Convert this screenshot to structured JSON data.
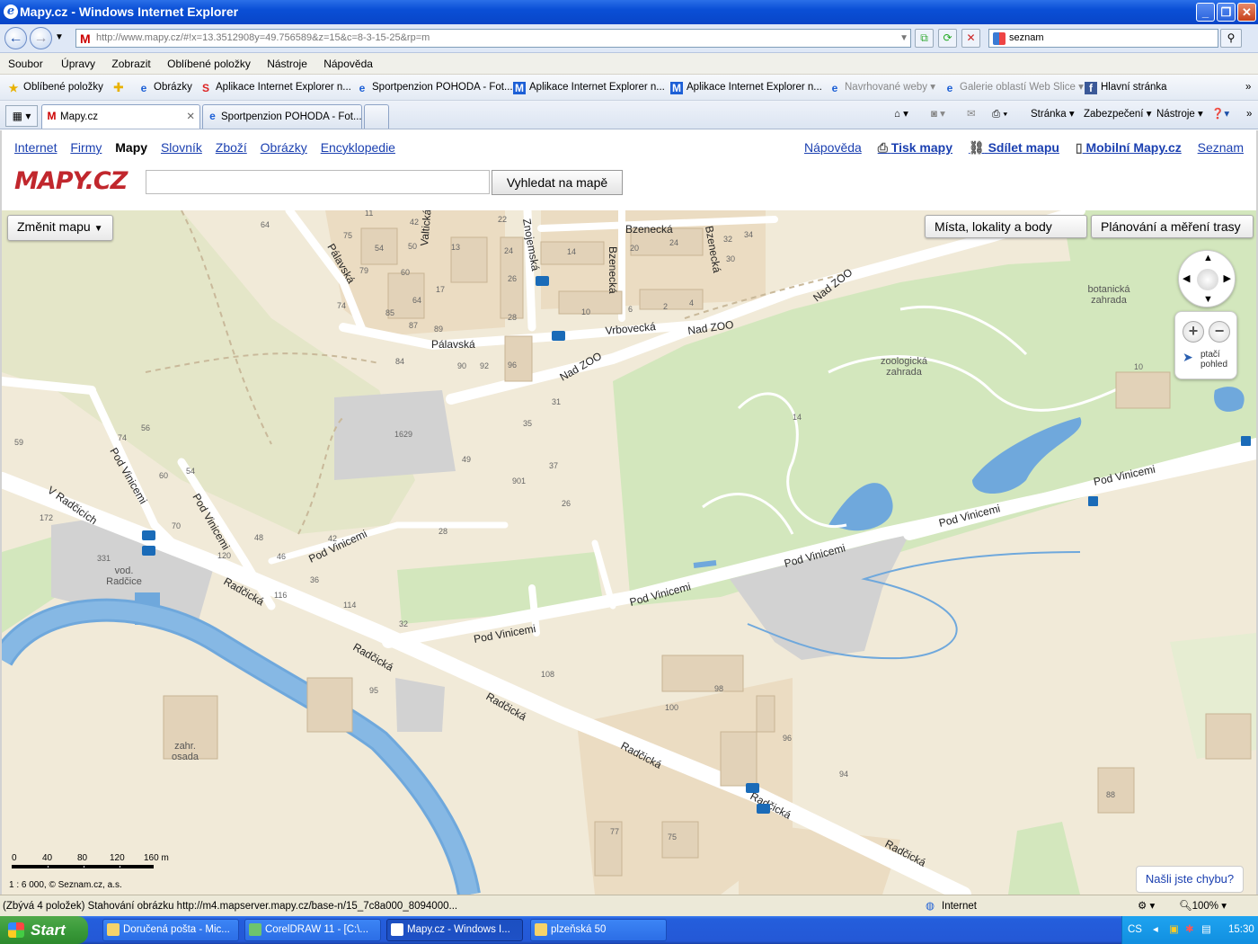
{
  "window": {
    "title": "Mapy.cz - Windows Internet Explorer"
  },
  "address": {
    "url": "http://www.mapy.cz/#!x=13.3512908y=49.756589&z=15&c=8-3-15-25&rp=m",
    "search_value": "seznam"
  },
  "menu": [
    "Soubor",
    "Úpravy",
    "Zobrazit",
    "Oblíbené položky",
    "Nástroje",
    "Nápověda"
  ],
  "favorites": {
    "label": "Oblíbené položky",
    "items": [
      "Obrázky",
      "Aplikace Internet Explorer n...",
      "Sportpenzion POHODA - Fot...",
      "Aplikace Internet Explorer n...",
      "Aplikace Internet Explorer n...",
      "Navrhované weby",
      "Galerie oblastí Web Slice",
      "Hlavní stránka"
    ]
  },
  "tabs": [
    {
      "label": "Mapy.cz",
      "active": true
    },
    {
      "label": "Sportpenzion POHODA - Fot...",
      "active": false
    }
  ],
  "commands": [
    "Stránka",
    "Zabezpečení",
    "Nástroje"
  ],
  "page": {
    "nav_left": [
      "Internet",
      "Firmy",
      "Mapy",
      "Slovník",
      "Zboží",
      "Obrázky",
      "Encyklopedie"
    ],
    "nav_right": [
      "Nápověda",
      "Tisk mapy",
      "Sdílet mapu",
      "Mobilní Mapy.cz",
      "Seznam"
    ],
    "logo": "MAPY.CZ",
    "search_button": "Vyhledat na mapě",
    "change_map": "Změnit mapu",
    "places_button": "Místa, lokality a body",
    "route_button": "Plánování a měření trasy",
    "bird_view": [
      "ptačí",
      "pohled"
    ],
    "report_error": "Našli jste chybu?",
    "scale_labels": [
      "0",
      "40",
      "80",
      "120",
      "160 m"
    ],
    "scale_note": "1 : 6 000, © Seznam.cz, a.s."
  },
  "map_labels": {
    "streets": [
      "Bzenecká",
      "Bzenecká",
      "Bzenecká",
      "Znojemská",
      "Valtická",
      "Pálavská",
      "Pálavská",
      "Vrbovecká",
      "Nad ZOO",
      "Nad ZOO",
      "Nad ZOO",
      "Pod Vinicemi",
      "Pod Vinicemi",
      "Pod Vinicemi",
      "Pod Vinicemi",
      "Pod Vinicemi",
      "Pod Vinicemi",
      "Pod Vinicemi",
      "Pod Vinicemi",
      "V Radčicích",
      "Radčická",
      "Radčická",
      "Radčická",
      "Radčická",
      "Radčická",
      "Radčická"
    ],
    "areas": [
      "botanická zahrada",
      "zoologická zahrada",
      "vod. Radčice",
      "zahr. osada"
    ],
    "numbers": [
      "64",
      "11",
      "75",
      "42",
      "54",
      "50",
      "13",
      "22",
      "24",
      "26",
      "28",
      "14",
      "20",
      "24",
      "32",
      "34",
      "30",
      "79",
      "60",
      "17",
      "74",
      "85",
      "64",
      "87",
      "89",
      "10",
      "6",
      "2",
      "4",
      "84",
      "90",
      "92",
      "96",
      "31",
      "35",
      "1629",
      "49",
      "37",
      "901",
      "26",
      "28",
      "56",
      "74",
      "60",
      "54",
      "70",
      "48",
      "46",
      "120",
      "116",
      "42",
      "36",
      "114",
      "32",
      "108",
      "95",
      "98",
      "100",
      "96",
      "94",
      "88",
      "77",
      "75",
      "14",
      "10",
      "59",
      "172",
      "331"
    ]
  },
  "status": {
    "text": "(Zbývá 4 položek) Stahování obrázku http://m4.mapserver.mapy.cz/base-n/15_7c8a000_8094000...",
    "zone": "Internet",
    "zoom": "100%"
  },
  "taskbar": {
    "start": "Start",
    "items": [
      "Doručená pošta - Mic...",
      "CorelDRAW 11 - [C:\\...",
      "Mapy.cz - Windows I...",
      "plzeňská 50"
    ],
    "lang": "CS",
    "time": "15:30"
  }
}
